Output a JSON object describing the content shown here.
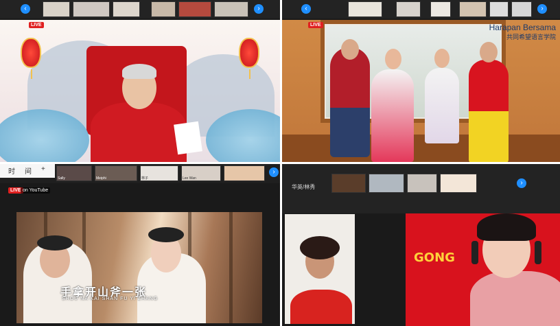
{
  "nav": {
    "prev_icon": "‹",
    "next_icon": "›"
  },
  "q1": {
    "live_label": "LIVE"
  },
  "q2": {
    "live_label": "LIVE",
    "sign_en": "Harapan Bersama",
    "sign_cn": "共同希望语言学院"
  },
  "q3": {
    "toolbar": {
      "item1": "时",
      "item2": "间",
      "item3": "+"
    },
    "thumb_names": [
      "Sally",
      "Meiphi",
      "林子",
      "Lee Wan"
    ],
    "live_label": "LIVE",
    "live_platform": "on YouTube",
    "lyric_cn": "手拿开山斧一张",
    "lyric_py": "SHOU  NA  KAI  SHAN  FU  YI  ZHANG"
  },
  "q4": {
    "name_tag": "华英/林秀",
    "gong_text": "GONG"
  },
  "colors": {
    "accent": "#1f8fff",
    "live": "#e02020"
  }
}
